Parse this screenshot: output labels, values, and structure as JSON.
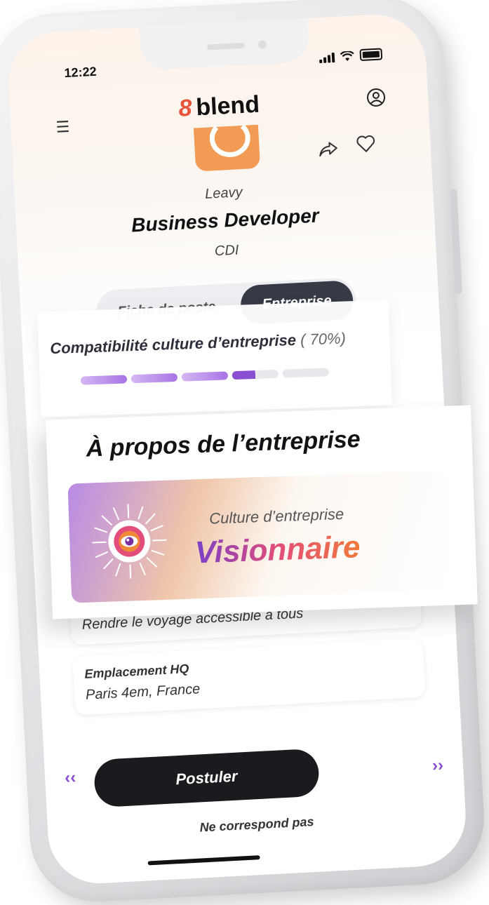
{
  "status": {
    "time": "12:22"
  },
  "brand": {
    "logo_mark": "8",
    "name": "blend"
  },
  "job": {
    "company": "Leavy",
    "title": "Business Developer",
    "contract": "CDI"
  },
  "tabs": [
    {
      "label": "Fiche de poste",
      "active": false
    },
    {
      "label": "Entreprise",
      "active": true
    }
  ],
  "compatibility": {
    "label": "Compatibilité culture d’entreprise",
    "percent_text": "( 70%)",
    "value": 0.7
  },
  "about": {
    "title": "À propos de l’entreprise",
    "culture_label": "Culture d’entreprise",
    "culture_value": "Visionnaire"
  },
  "cards": [
    {
      "label": "",
      "value": "Rendre le voyage accessible à tous"
    },
    {
      "label": "Emplacement HQ",
      "value": "Paris 4em, France"
    }
  ],
  "actions": {
    "apply": "Postuler",
    "skip": "Ne correspond pas",
    "prev": "‹‹",
    "next": "››"
  },
  "colors": {
    "accent": "#8a4fd1",
    "logo_orange": "#f29b55",
    "dark_button": "#1b1b1f",
    "active_tab": "#363a45"
  }
}
